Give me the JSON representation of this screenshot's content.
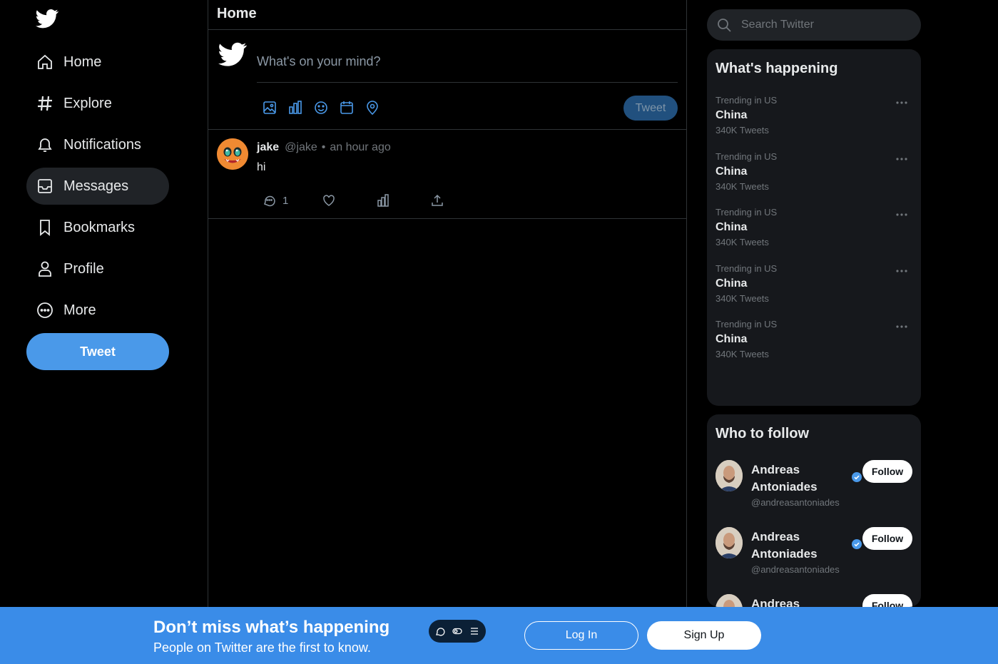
{
  "nav": {
    "items": [
      {
        "label": "Home",
        "icon": "home-icon"
      },
      {
        "label": "Explore",
        "icon": "hashtag-icon"
      },
      {
        "label": "Notifications",
        "icon": "bell-icon"
      },
      {
        "label": "Messages",
        "icon": "envelope-icon",
        "active": true
      },
      {
        "label": "Bookmarks",
        "icon": "bookmark-icon"
      },
      {
        "label": "Profile",
        "icon": "user-icon"
      },
      {
        "label": "More",
        "icon": "more-circle-icon"
      }
    ],
    "tweet_label": "Tweet"
  },
  "main": {
    "title": "Home",
    "composer": {
      "placeholder": "What's on your mind?",
      "submit_label": "Tweet",
      "tools": [
        "image-icon",
        "poll-icon",
        "emoji-icon",
        "schedule-icon",
        "location-icon"
      ]
    },
    "post": {
      "name": "jake",
      "handle": "@jake",
      "separator": "•",
      "time": "an hour ago",
      "body": "hi",
      "reply_count": "1"
    }
  },
  "search": {
    "placeholder": "Search Twitter"
  },
  "trends": {
    "title": "What's happening",
    "items": [
      {
        "context": "Trending in US",
        "name": "China",
        "count": "340K Tweets"
      },
      {
        "context": "Trending in US",
        "name": "China",
        "count": "340K Tweets"
      },
      {
        "context": "Trending in US",
        "name": "China",
        "count": "340K Tweets"
      },
      {
        "context": "Trending in US",
        "name": "China",
        "count": "340K Tweets"
      },
      {
        "context": "Trending in US",
        "name": "China",
        "count": "340K Tweets"
      }
    ]
  },
  "who_to_follow": {
    "title": "Who to follow",
    "items": [
      {
        "name": "Andreas Antoniades",
        "handle": "@andreasantoniades",
        "button": "Follow"
      },
      {
        "name": "Andreas Antoniades",
        "handle": "@andreasantoniades",
        "button": "Follow"
      },
      {
        "name": "Andreas",
        "handle": "",
        "button": "Follow"
      }
    ]
  },
  "banner": {
    "title": "Don’t miss what’s happening",
    "subtitle": "People on Twitter are the first to know.",
    "login_label": "Log In",
    "signup_label": "Sign Up"
  },
  "colors": {
    "accent": "#4a99e9",
    "banner": "#3a8ce8",
    "background": "#000000",
    "panel": "#16181c"
  }
}
